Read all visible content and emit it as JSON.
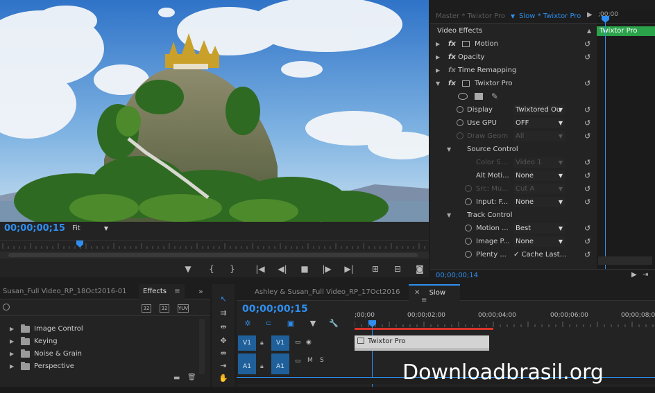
{
  "program": {
    "timecode": "00;00;00;15",
    "zoom": "Fit"
  },
  "effect_controls": {
    "tab_master": "Master * Twixtor Pro",
    "tab_clip": "Slow * Twixtor Pro",
    "section_title": "Video Effects",
    "footer_timecode": "00;00;00;14",
    "mini_ruler_time": ";00;00",
    "mini_clip_label": "Twixtor Pro",
    "rows": [
      {
        "label": "Motion"
      },
      {
        "label": "Opacity"
      },
      {
        "label": "Time Remapping"
      },
      {
        "label": "Twixtor Pro"
      },
      {
        "label": "Display",
        "value": "Twixtored Ou"
      },
      {
        "label": "Use GPU",
        "value": "OFF"
      },
      {
        "label": "Draw Geom",
        "value": "All"
      },
      {
        "label": "Source Control"
      },
      {
        "label": "Color S...",
        "value": "Video 1"
      },
      {
        "label": "Alt Moti...",
        "value": "None"
      },
      {
        "label": "Src: Mu...",
        "value": "Cut A"
      },
      {
        "label": "Input: F...",
        "value": "None"
      },
      {
        "label": "Track Control"
      },
      {
        "label": "Motion ...",
        "value": "Best"
      },
      {
        "label": "Image P...",
        "value": "None"
      },
      {
        "label": "Plenty ...",
        "value": "Cache Last..."
      }
    ]
  },
  "effects_panel": {
    "tab_project": "Susan_Full Video_RP_18Oct2016-01",
    "tab_effects": "Effects",
    "badges": [
      "32",
      "32",
      "YUV"
    ],
    "folders": [
      "Image Control",
      "Keying",
      "Noise & Grain",
      "Perspective"
    ]
  },
  "timeline": {
    "tab_sequence1": "Ashley & Susan_Full Video_RP_17Oct2016",
    "tab_sequence2": "Slow",
    "timecode": "00;00;00;15",
    "ruler": [
      ";00;00",
      "00;00;02;00",
      "00;00;04;00",
      "00;00;06;00",
      "00;00;08;0"
    ],
    "tracks": {
      "v1_source": "V1",
      "v1_target": "V1",
      "a1_source": "A1",
      "a1_target": "A1",
      "mute": "M",
      "solo": "S"
    },
    "clip_label": "Twixtor Pro"
  },
  "watermark": "Downloadbrasil.org",
  "colors": {
    "accent": "#2f8ff0",
    "clip_green": "#2ba34a",
    "in_out_red": "#d9342b"
  }
}
